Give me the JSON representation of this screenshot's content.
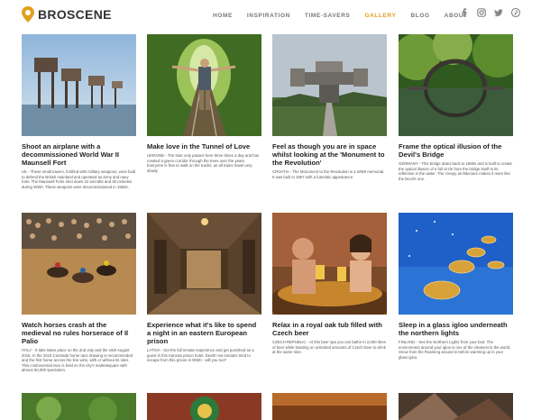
{
  "brand": {
    "name": "BROSCENE"
  },
  "nav": [
    {
      "label": "HOME",
      "active": false
    },
    {
      "label": "INSPIRATION",
      "active": false
    },
    {
      "label": "TIME-SAVERS",
      "active": false
    },
    {
      "label": "GALLERY",
      "active": true
    },
    {
      "label": "BLOG",
      "active": false
    },
    {
      "label": "ABOUT",
      "active": false
    }
  ],
  "social": [
    "facebook-icon",
    "instagram-icon",
    "twitter-icon",
    "pinterest-icon"
  ],
  "accent_color": "#e0a01e",
  "cards": [
    {
      "title": "Shoot an airplane with a decommissioned World War II Maunsell Fort",
      "desc": "UK - These small towers, fortified with military weapons, were built to defend the British mainland and operated as army and navy forts. The Maunsell Forts shot down 22 aircrafts and 30 rocketss during WWII. These weapons were decommissioned in 1950s."
    },
    {
      "title": "Make love in the Tunnel of Love",
      "desc": "UKRAINE - The train only passes here three times a day and has created a green corridor through the trees over the years. Everyone is free to walk on the tracks, as all trains travel very slowly."
    },
    {
      "title": "Feel as though you are in space whilst looking at the 'Monument to the Revolution'",
      "desc": "CROATIA - The Monument to the Revolution is a WWII memorial. It was built in 1967 with a futuristic appearance."
    },
    {
      "title": "Frame the optical illusion of the Devil's Bridge",
      "desc": "GERMANY - This bridge dates back to 1860s and is built to create the optical illusion of a full circle from the bridge itself to its reflection in the water. The creepy architecture makes it more like the Devil's one."
    },
    {
      "title": "Watch horses crash at the medieval no rules horserace of Il Palio",
      "desc": "ITALY - It take takes place on the 2nd July and the 16th August 2015. In the 2015 Contrade horse race drawing is recommended and the first horse across the line wins, with or without its rider. This controversial race is held on the city's marketsquare with almost 50,000 spectators."
    },
    {
      "title": "Experience what it's like to spend a night in an eastern European prison",
      "desc": "LATVIA - Get the full inmate experience and get punished as a guest in this Karosta prison hotel. Death row inmates tried to escape from this prison in WWII - will you too?"
    },
    {
      "title": "Relax in a royal oak tub filled with Czech beer",
      "desc": "CZECH REPUBLIC - At this beer spa you can bathe in 2,000 litres of beer while feasting on unlimited amounts of Czech beer to drink at the same time."
    },
    {
      "title": "Sleep in a glass igloo underneath the northern lights",
      "desc": "FINLAND - See the Northern Lights from your bed. The environment around your igloo is one of the cleanest in the world. Snow from the Roaming around in before warming up in your glass igloo."
    }
  ]
}
